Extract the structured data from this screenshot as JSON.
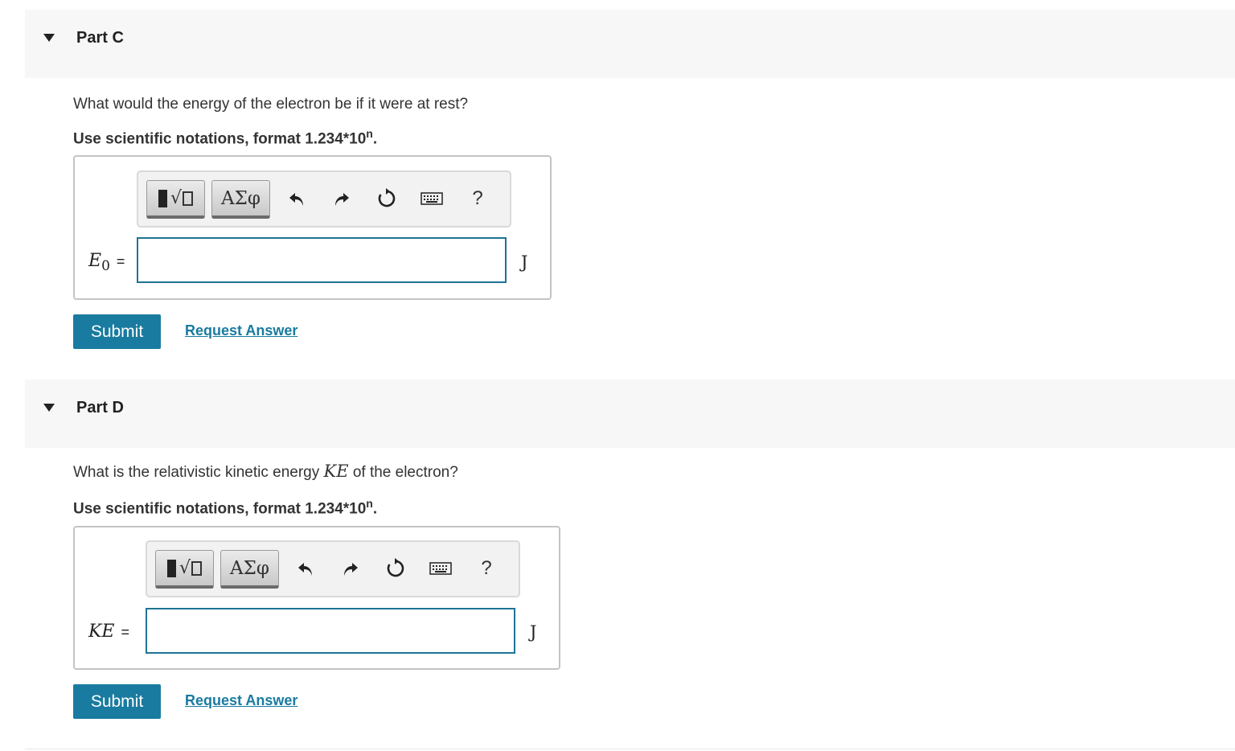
{
  "parts": [
    {
      "title": "Part C",
      "question": "What would the energy of the electron be if it were at rest?",
      "question_math": "",
      "question_suffix": "",
      "instruction_prefix": "Use scientific notations, format 1.234*10",
      "instruction_sup": "n",
      "instruction_suffix": ".",
      "toolbar": {
        "symbols_label": "ΑΣφ",
        "help_label": "?"
      },
      "label_main": "E",
      "label_sub": "0",
      "label_eq": "=",
      "input_value": "",
      "unit": "J",
      "submit_label": "Submit",
      "request_label": "Request Answer"
    },
    {
      "title": "Part D",
      "question": "What is the relativistic kinetic energy ",
      "question_math": "KE",
      "question_suffix": " of the electron?",
      "instruction_prefix": "Use scientific notations, format 1.234*10",
      "instruction_sup": "n",
      "instruction_suffix": ".",
      "toolbar": {
        "symbols_label": "ΑΣφ",
        "help_label": "?"
      },
      "label_main": "KE",
      "label_sub": "",
      "label_eq": "=",
      "input_value": "",
      "unit": "J",
      "submit_label": "Submit",
      "request_label": "Request Answer"
    }
  ]
}
